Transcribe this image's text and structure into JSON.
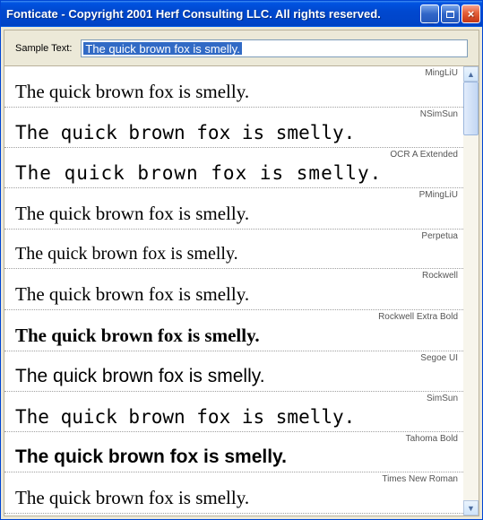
{
  "window": {
    "title": "Fonticate - Copyright 2001 Herf Consulting LLC.  All rights reserved."
  },
  "toolbar": {
    "label": "Sample Text:",
    "value": "The quick brown fox is smelly."
  },
  "fonts": [
    {
      "name": "MingLiU",
      "css": "f-mingliu"
    },
    {
      "name": "NSimSun",
      "css": "f-nsimsun"
    },
    {
      "name": "OCR A Extended",
      "css": "f-ocra"
    },
    {
      "name": "PMingLiU",
      "css": "f-pmingliu"
    },
    {
      "name": "Perpetua",
      "css": "f-perpetua"
    },
    {
      "name": "Rockwell",
      "css": "f-rockwell"
    },
    {
      "name": "Rockwell Extra Bold",
      "css": "f-rockwellb"
    },
    {
      "name": "Segoe UI",
      "css": "f-segoe"
    },
    {
      "name": "SimSun",
      "css": "f-simsun"
    },
    {
      "name": "Tahoma Bold",
      "css": "f-tahomab"
    },
    {
      "name": "Times New Roman",
      "css": "f-times"
    }
  ]
}
